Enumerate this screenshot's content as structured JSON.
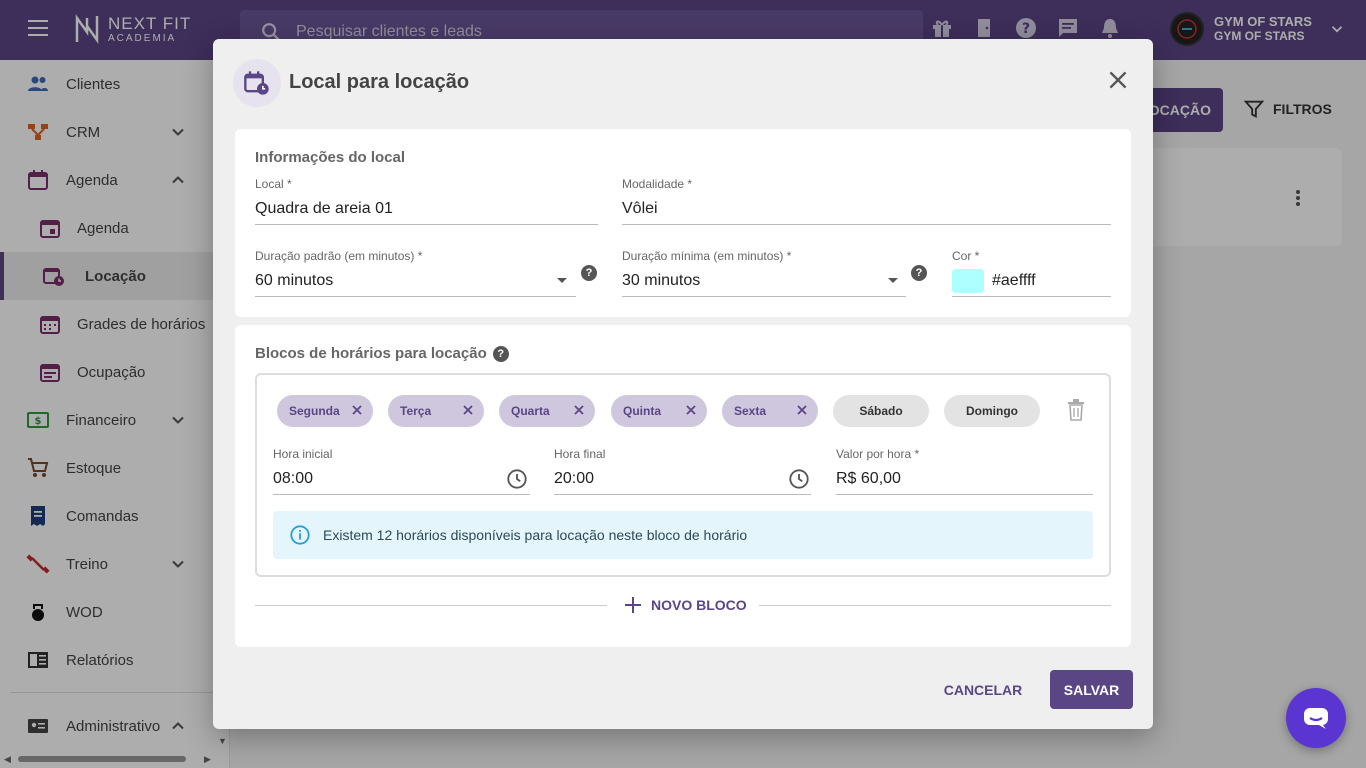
{
  "brand": {
    "name": "NEXT FIT",
    "subtitle": "ACADEMIA"
  },
  "search": {
    "placeholder": "Pesquisar clientes e leads"
  },
  "account": {
    "name": "GYM OF STARS",
    "subname": "GYM OF STARS"
  },
  "sidebar": {
    "items": [
      {
        "label": "Clientes"
      },
      {
        "label": "CRM"
      },
      {
        "label": "Agenda"
      },
      {
        "label": "Agenda"
      },
      {
        "label": "Locação"
      },
      {
        "label": "Grades de horários"
      },
      {
        "label": "Ocupação"
      },
      {
        "label": "Financeiro"
      },
      {
        "label": "Estoque"
      },
      {
        "label": "Comandas"
      },
      {
        "label": "Treino"
      },
      {
        "label": "WOD"
      },
      {
        "label": "Relatórios"
      },
      {
        "label": "Administrativo"
      }
    ]
  },
  "background": {
    "new_button": "OCAÇÃO",
    "filters": "FILTROS"
  },
  "modal": {
    "title": "Local para locação",
    "info_section": {
      "title": "Informações do local",
      "local": {
        "label": "Local *",
        "value": "Quadra de areia 01"
      },
      "modalidade": {
        "label": "Modalidade *",
        "value": "Vôlei"
      },
      "duracao_padrao": {
        "label": "Duração padrão (em minutos) *",
        "value": "60 minutos"
      },
      "duracao_minima": {
        "label": "Duração mínima (em minutos) *",
        "value": "30 minutos"
      },
      "cor": {
        "label": "Cor *",
        "value": "#aeffff",
        "swatch": "#aeffff"
      }
    },
    "blocks_section": {
      "title": "Blocos de horários para locação",
      "days": [
        {
          "label": "Segunda",
          "selected": true
        },
        {
          "label": "Terça",
          "selected": true
        },
        {
          "label": "Quarta",
          "selected": true
        },
        {
          "label": "Quinta",
          "selected": true
        },
        {
          "label": "Sexta",
          "selected": true
        },
        {
          "label": "Sábado",
          "selected": false
        },
        {
          "label": "Domingo",
          "selected": false
        }
      ],
      "hora_inicial": {
        "label": "Hora inicial",
        "value": "08:00"
      },
      "hora_final": {
        "label": "Hora final",
        "value": "20:00"
      },
      "valor_hora": {
        "label": "Valor por hora *",
        "value": "R$ 60,00"
      },
      "info": "Existem 12 horários disponíveis para locação neste bloco de horário",
      "add_block": "NOVO BLOCO"
    },
    "actions": {
      "cancel": "CANCELAR",
      "save": "SALVAR"
    }
  },
  "colors": {
    "primary": "#5a4585",
    "chip": "#cfc7de",
    "info_bg": "#e5f5fc"
  }
}
